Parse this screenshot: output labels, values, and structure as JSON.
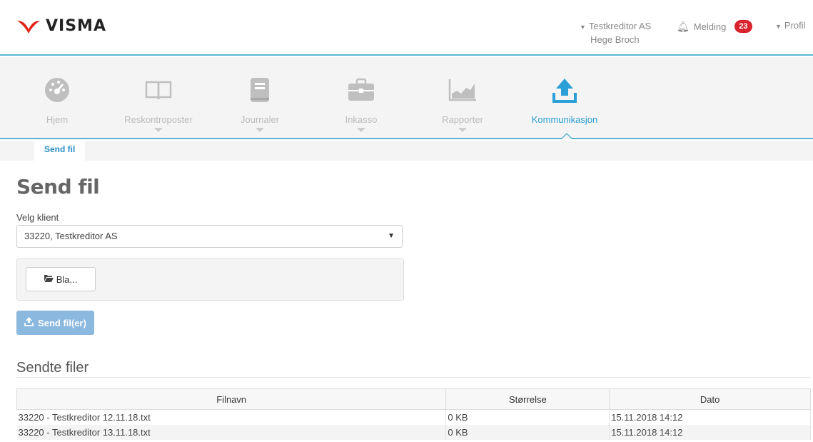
{
  "brand": {
    "name": "VISMA",
    "red": "#e2231a"
  },
  "header": {
    "company": "Testkreditor AS",
    "user": "Hege Broch",
    "notifications_label": "Melding",
    "notifications_count": "23",
    "profile_label": "Profil"
  },
  "nav": {
    "items": [
      {
        "label": "Hjem",
        "icon": "dashboard-icon",
        "has_menu": false
      },
      {
        "label": "Reskontroposter",
        "icon": "book-icon",
        "has_menu": true
      },
      {
        "label": "Journaler",
        "icon": "journal-icon",
        "has_menu": true
      },
      {
        "label": "Inkasso",
        "icon": "briefcase-icon",
        "has_menu": true
      },
      {
        "label": "Rapporter",
        "icon": "chart-icon",
        "has_menu": true
      },
      {
        "label": "Kommunikasjon",
        "icon": "upload-icon",
        "has_menu": false,
        "active": true
      }
    ],
    "subtab": "Send fil"
  },
  "page": {
    "title": "Send fil",
    "client_label": "Velg klient",
    "client_value": "33220, Testkreditor AS",
    "browse_label": "Bla...",
    "send_label": "Send fil(er)"
  },
  "sent": {
    "title": "Sendte filer",
    "columns": [
      "Filnavn",
      "Størrelse",
      "Dato"
    ],
    "rows": [
      [
        "33220 - Testkreditor 12.11.18.txt",
        "0 KB",
        "15.11.2018 14:12"
      ],
      [
        "33220 - Testkreditor 13.11.18.txt",
        "0 KB",
        "15.11.2018 14:12"
      ]
    ]
  },
  "colors": {
    "accent": "#2aa0d6",
    "badge": "#d9232e",
    "send_button": "#8ab8de"
  }
}
